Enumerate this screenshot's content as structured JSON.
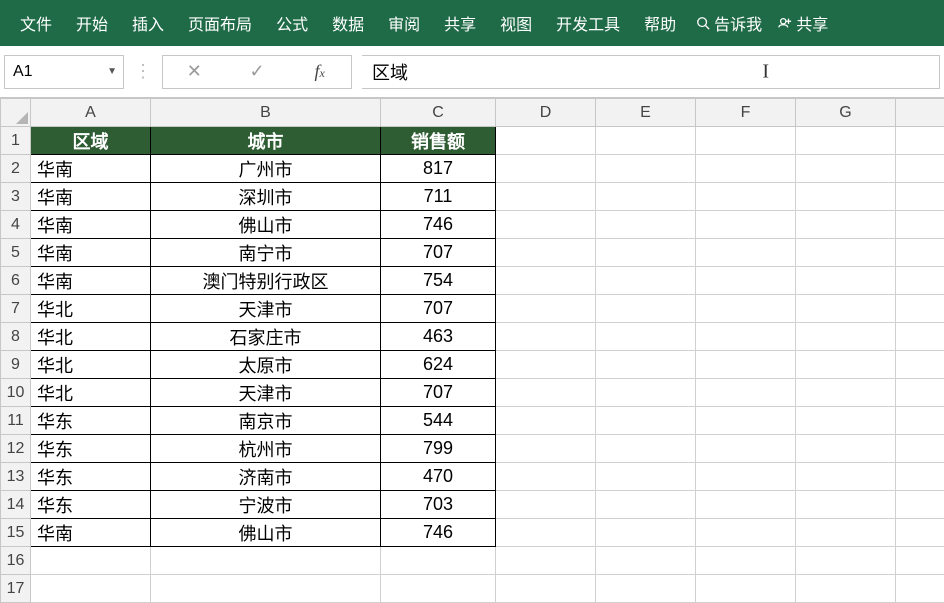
{
  "ribbon": {
    "tabs": [
      "文件",
      "开始",
      "插入",
      "页面布局",
      "公式",
      "数据",
      "审阅",
      "共享",
      "视图",
      "开发工具",
      "帮助"
    ],
    "tell_me": "告诉我",
    "share": "共享"
  },
  "formula_bar": {
    "name_box": "A1",
    "formula": "区域"
  },
  "columns": [
    "A",
    "B",
    "C",
    "D",
    "E",
    "F",
    "G"
  ],
  "chart_data": {
    "type": "table",
    "headers": [
      "区域",
      "城市",
      "销售额"
    ],
    "rows": [
      {
        "region": "华南",
        "city": "广州市",
        "sales": "817"
      },
      {
        "region": "华南",
        "city": "深圳市",
        "sales": "711"
      },
      {
        "region": "华南",
        "city": "佛山市",
        "sales": "746"
      },
      {
        "region": "华南",
        "city": "南宁市",
        "sales": "707"
      },
      {
        "region": "华南",
        "city": "澳门特别行政区",
        "sales": "754"
      },
      {
        "region": "华北",
        "city": "天津市",
        "sales": "707"
      },
      {
        "region": "华北",
        "city": "石家庄市",
        "sales": "463"
      },
      {
        "region": "华北",
        "city": "太原市",
        "sales": "624"
      },
      {
        "region": "华北",
        "city": "天津市",
        "sales": "707"
      },
      {
        "region": "华东",
        "city": "南京市",
        "sales": "544"
      },
      {
        "region": "华东",
        "city": "杭州市",
        "sales": "799"
      },
      {
        "region": "华东",
        "city": "济南市",
        "sales": "470"
      },
      {
        "region": "华东",
        "city": "宁波市",
        "sales": "703"
      },
      {
        "region": "华南",
        "city": "佛山市",
        "sales": "746"
      }
    ]
  },
  "visible_row_count": 17
}
